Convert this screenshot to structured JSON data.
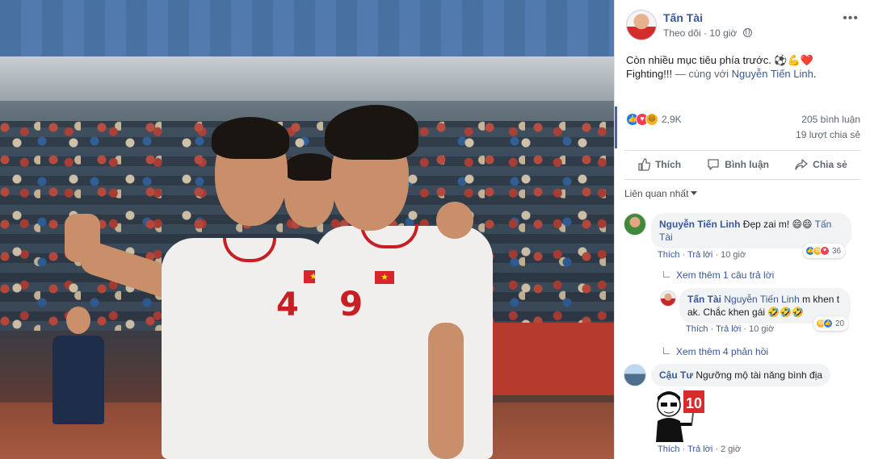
{
  "post": {
    "author": "Tấn Tài",
    "follow": "Theo dõi",
    "time": "10 giờ",
    "more": "•••",
    "text_line1": "Còn nhiều mục tiêu phía trước. ⚽💪❤️",
    "text_line2_prefix": "Fighting!!!",
    "text_with": " — cùng với ",
    "tagged": "Nguyễn Tiến Linh",
    "text_end": "."
  },
  "stats": {
    "reactions": "2,9K",
    "comments": "205 bình luận",
    "shares": "19 lượt chia sẻ",
    "reaction_icons": [
      "like-icon",
      "love-icon",
      "haha-icon"
    ]
  },
  "actions": {
    "like": "Thích",
    "comment": "Bình luận",
    "share": "Chia sẻ"
  },
  "sort": {
    "label": "Liên quan nhất"
  },
  "comments": [
    {
      "name": "Nguyễn Tiến Linh",
      "text": "Đẹp zai m! 😄😄 ",
      "mention": "Tấn Tài",
      "like": "Thích",
      "reply": "Trả lời",
      "time": "10 giờ",
      "reaction_count": "36",
      "more_replies": "Xem thêm 1 câu trả lời"
    },
    {
      "name": "Tấn Tài",
      "mention": "Nguyễn Tiến Linh",
      "text": " m khen t ak. Chắc khen gái 🤣🤣🤣",
      "like": "Thích",
      "reply": "Trả lời",
      "time": "10 giờ",
      "reaction_count": "20"
    },
    {
      "more_replies": "Xem thêm 4 phản hồi"
    },
    {
      "name": "Cậu Tư",
      "text": " Ngưỡng mộ tài năng bình địa",
      "like": "Thích",
      "reply": "Trả lời",
      "time": "2 giờ",
      "sticker_text": "10"
    }
  ],
  "photo": {
    "left_player_number": "4",
    "right_player_number": "9",
    "flag_symbol": "★"
  },
  "colors": {
    "link": "#385898",
    "meta": "#606770",
    "like_blue": "#2078f4",
    "love_red": "#f33e58",
    "haha_yellow": "#f7b125",
    "jersey_red": "#c61f24"
  }
}
